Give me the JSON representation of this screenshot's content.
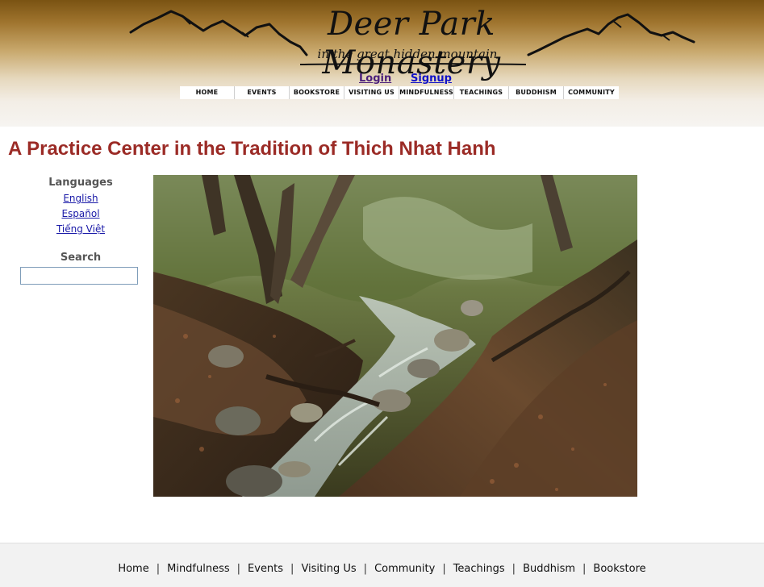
{
  "header": {
    "logo_title": "Deer Park Monastery",
    "logo_subtitle": "in the great hidden mountain",
    "login": "Login",
    "signup": "Signup"
  },
  "topnav": [
    "HOME",
    "EVENTS",
    "BOOKSTORE",
    "VISITING US",
    "MINDFULNESS",
    "TEACHINGS",
    "BUDDHISM",
    "COMMUNITY"
  ],
  "page_title": "A Practice Center in the Tradition of Thich Nhat Hanh",
  "sidebar": {
    "languages_heading": "Languages",
    "languages": [
      "English",
      "Español",
      "Tiếng Việt"
    ],
    "search_heading": "Search",
    "search_value": ""
  },
  "main": {
    "photo_icon": "forest-creek-photo"
  },
  "footer": {
    "links": [
      "Home",
      "Mindfulness",
      "Events",
      "Visiting Us",
      "Community",
      "Teachings",
      "Buddhism",
      "Bookstore"
    ],
    "separator": "|"
  },
  "colors": {
    "title": "#9b2b26",
    "link": "#1a1aa8",
    "header_top": "#7a5312"
  }
}
